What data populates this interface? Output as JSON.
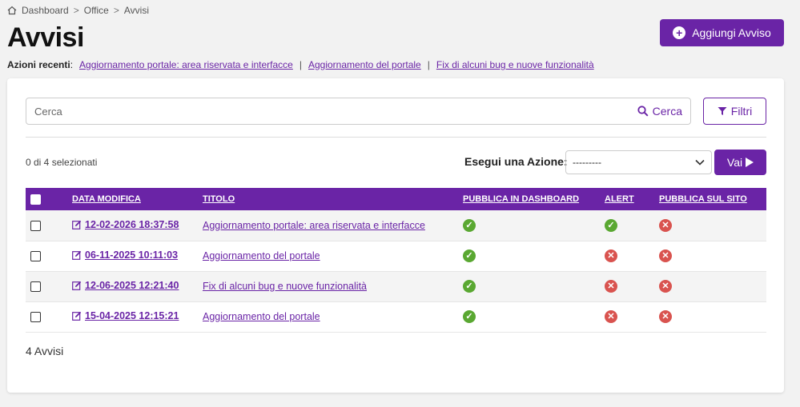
{
  "breadcrumb": {
    "items": [
      "Dashboard",
      "Office",
      "Avvisi"
    ],
    "sep": ">"
  },
  "page": {
    "title": "Avvisi"
  },
  "add_button": {
    "label": "Aggiungi Avviso"
  },
  "recent": {
    "label": "Azioni recenti",
    "colon": ":",
    "pipe": "|",
    "links": [
      "Aggiornamento portale: area riservata e interfacce",
      "Aggiornamento del portale",
      "Fix di alcuni bug e nuove funzionalità"
    ]
  },
  "search": {
    "placeholder": "Cerca",
    "button_label": "Cerca"
  },
  "filters": {
    "label": "Filtri"
  },
  "selection": {
    "text": "0 di 4 selezionati"
  },
  "actions": {
    "label": "Esegui una Azione:",
    "selected": "---------",
    "go_label": "Vai"
  },
  "table": {
    "headers": [
      "DATA MODIFICA",
      "TITOLO",
      "PUBBLICA IN DASHBOARD",
      "ALERT",
      "PUBBLICA SUL SITO"
    ],
    "rows": [
      {
        "date": "12-02-2026 18:37:58",
        "title": "Aggiornamento portale: area riservata e interfacce",
        "dashboard": true,
        "alert": true,
        "site": false
      },
      {
        "date": "06-11-2025 10:11:03",
        "title": "Aggiornamento del portale",
        "dashboard": true,
        "alert": false,
        "site": false
      },
      {
        "date": "12-06-2025 12:21:40",
        "title": "Fix di alcuni bug e nuove funzionalità",
        "dashboard": true,
        "alert": false,
        "site": false
      },
      {
        "date": "15-04-2025 12:15:21",
        "title": "Aggiornamento del portale",
        "dashboard": true,
        "alert": false,
        "site": false
      }
    ]
  },
  "footer": {
    "count": "4 Avvisi"
  },
  "colors": {
    "accent": "#6a24a6",
    "ok": "#5aa832",
    "no": "#d9534f"
  }
}
